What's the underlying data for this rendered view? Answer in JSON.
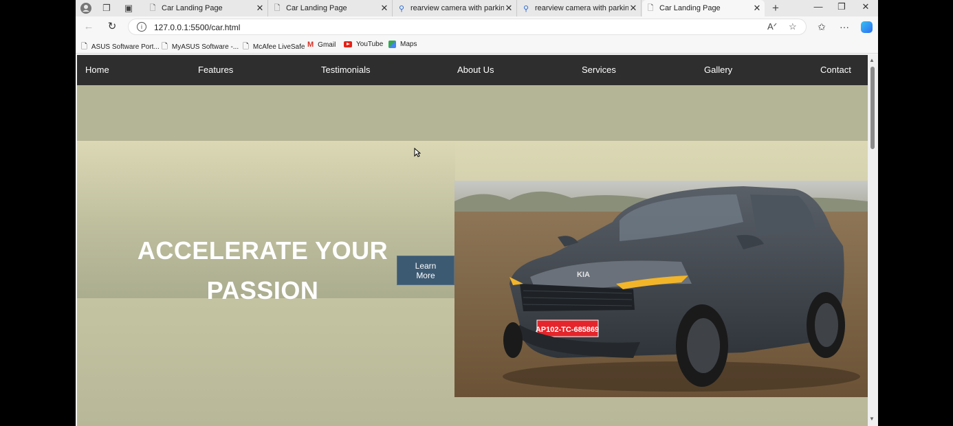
{
  "browser": {
    "tabs": [
      {
        "title": "Car Landing Page",
        "icon": "page-icon",
        "active": false
      },
      {
        "title": "Car Landing Page",
        "icon": "page-icon",
        "active": false
      },
      {
        "title": "rearview camera with parking sen",
        "icon": "search-icon",
        "active": false
      },
      {
        "title": "rearview camera with parking sen",
        "icon": "search-icon",
        "active": false
      },
      {
        "title": "Car Landing Page",
        "icon": "page-icon",
        "active": true
      }
    ],
    "url": "127.0.0.1:5500/car.html",
    "bookmarks": [
      {
        "label": "ASUS Software Port...",
        "icon": "page-icon"
      },
      {
        "label": "MyASUS Software -...",
        "icon": "page-icon"
      },
      {
        "label": "McAfee LiveSafe",
        "icon": "page-icon"
      },
      {
        "label": "Gmail",
        "icon": "gmail-icon"
      },
      {
        "label": "YouTube",
        "icon": "youtube-icon"
      },
      {
        "label": "Maps",
        "icon": "maps-icon"
      }
    ]
  },
  "page": {
    "nav": [
      "Home",
      "Features",
      "Testimonials",
      "About Us",
      "Services",
      "Gallery",
      "Contact"
    ],
    "headline_line1": "ACCELERATE YOUR",
    "headline_line2": "PASSION",
    "cta": {
      "line1": "Learn",
      "line2": "More"
    },
    "car_plate": "AP102-TC-685869",
    "car_badge": "KIA"
  },
  "colors": {
    "navbar": "#2e2e2e",
    "band": "#b4b596",
    "hero": "#d9d6b6",
    "button": "#3d5a73"
  }
}
